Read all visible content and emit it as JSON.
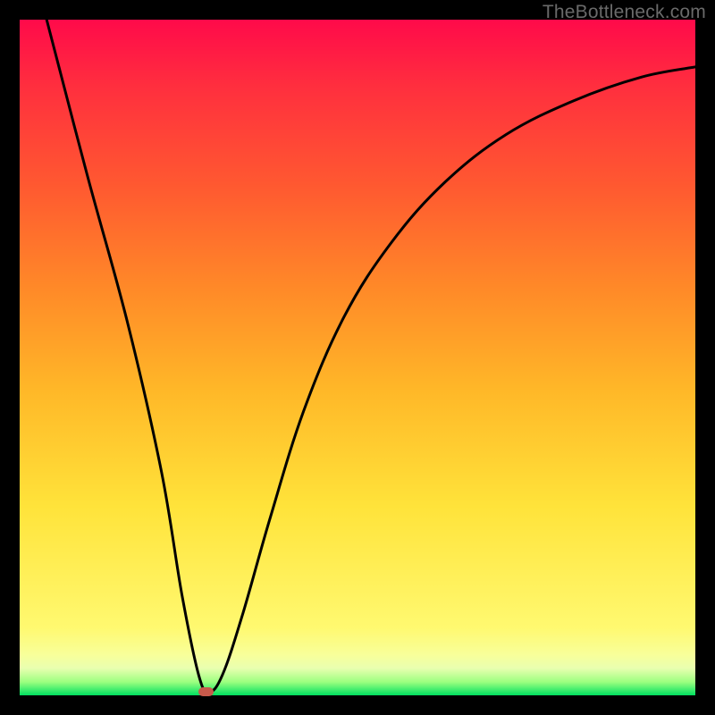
{
  "attribution": "TheBottleneck.com",
  "chart_data": {
    "type": "line",
    "title": "",
    "xlabel": "",
    "ylabel": "",
    "xlim": [
      0,
      100
    ],
    "ylim": [
      0,
      100
    ],
    "series": [
      {
        "name": "bottleneck-curve",
        "x": [
          4,
          10,
          16,
          21,
          24,
          26.5,
          28,
          30,
          33,
          37,
          42,
          48,
          55,
          63,
          72,
          82,
          92,
          100
        ],
        "values": [
          100,
          77,
          55,
          33,
          15,
          3,
          0.5,
          3,
          12,
          26,
          42,
          56,
          67,
          76,
          83,
          88,
          91.5,
          93
        ]
      }
    ],
    "marker": {
      "x": 27.5,
      "y": 0.5
    },
    "background_gradient": {
      "stops": [
        {
          "pos": 0,
          "color": "#ff0a4a"
        },
        {
          "pos": 25,
          "color": "#ff5a30"
        },
        {
          "pos": 55,
          "color": "#ffb828"
        },
        {
          "pos": 90,
          "color": "#fff970"
        },
        {
          "pos": 100,
          "color": "#00e060"
        }
      ]
    }
  }
}
